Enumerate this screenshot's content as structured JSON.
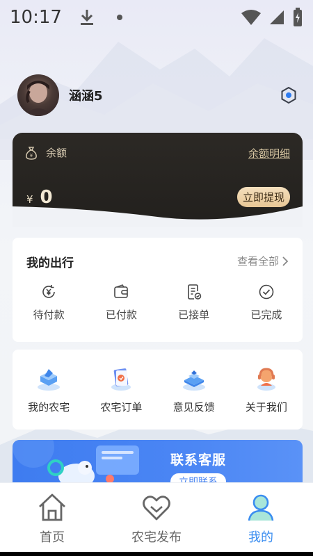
{
  "status_bar": {
    "time": "10:17"
  },
  "profile": {
    "username": "涵涵5"
  },
  "balance": {
    "label": "余额",
    "detail_link": "余额明细",
    "currency": "¥",
    "amount": "0",
    "withdraw_button": "立即提现"
  },
  "trips": {
    "title": "我的出行",
    "view_all": "查看全部",
    "items": [
      {
        "label": "待付款",
        "icon": "yuan-refresh-icon"
      },
      {
        "label": "已付款",
        "icon": "wallet-icon"
      },
      {
        "label": "已接单",
        "icon": "clipboard-check-icon"
      },
      {
        "label": "已完成",
        "icon": "check-circle-icon"
      }
    ]
  },
  "services": {
    "items": [
      {
        "label": "我的农宅",
        "icon": "house-3d-icon"
      },
      {
        "label": "农宅订单",
        "icon": "order-3d-icon"
      },
      {
        "label": "意见反馈",
        "icon": "feedback-3d-icon"
      },
      {
        "label": "关于我们",
        "icon": "about-3d-icon"
      }
    ]
  },
  "banner": {
    "title": "联系客服",
    "button": "立即联系"
  },
  "tabbar": {
    "tabs": [
      {
        "label": "首页",
        "icon": "home-icon",
        "active": false
      },
      {
        "label": "农宅发布",
        "icon": "heart-publish-icon",
        "active": false
      },
      {
        "label": "我的",
        "icon": "user-icon",
        "active": true
      }
    ]
  },
  "colors": {
    "accent": "#3a8df0",
    "card_dark": "#2c2925",
    "gold": "#d8c7a3",
    "banner_blue": "#3e7cf0"
  }
}
